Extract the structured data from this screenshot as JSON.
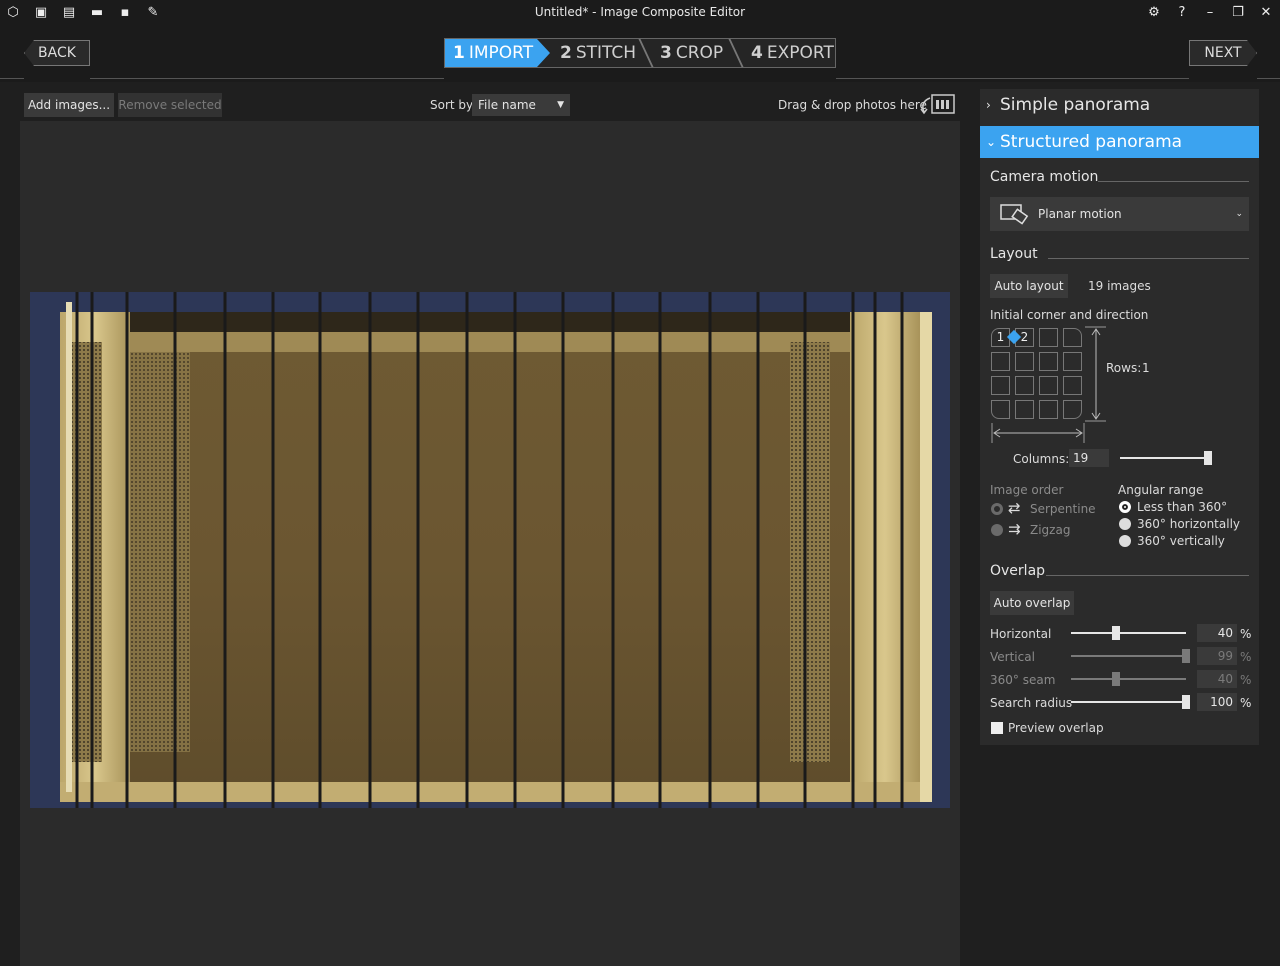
{
  "window": {
    "title": "Untitled* - Image Composite Editor"
  },
  "nav": {
    "back": "BACK",
    "next": "NEXT"
  },
  "steps": [
    {
      "num": "1",
      "label": "IMPORT"
    },
    {
      "num": "2",
      "label": "STITCH"
    },
    {
      "num": "3",
      "label": "CROP"
    },
    {
      "num": "4",
      "label": "EXPORT"
    }
  ],
  "toolbar": {
    "add_images": "Add images...",
    "remove_selected": "Remove selected",
    "sort_by": "Sort by",
    "sort_value": "File name",
    "drag_drop": "Drag & drop photos here"
  },
  "panel": {
    "simple": "Simple panorama",
    "structured": "Structured panorama",
    "camera_motion": "Camera motion",
    "camera_motion_value": "Planar motion",
    "layout": "Layout",
    "auto_layout": "Auto layout",
    "image_count": "19 images",
    "initial_corner": "Initial corner and direction",
    "grid_1": "1",
    "grid_2": "2",
    "rows_label": "Rows:",
    "rows_value": "1",
    "columns_label": "Columns:",
    "columns_value": "19",
    "image_order": "Image order",
    "serpentine": "Serpentine",
    "zigzag": "Zigzag",
    "angular_range": "Angular range",
    "less_than_360": "Less than 360°",
    "h360": "360° horizontally",
    "v360": "360° vertically",
    "overlap": "Overlap",
    "auto_overlap": "Auto overlap",
    "horizontal": "Horizontal",
    "horizontal_value": "40",
    "vertical": "Vertical",
    "vertical_value": "99",
    "seam": "360° seam",
    "seam_value": "40",
    "search_radius": "Search radius",
    "search_radius_value": "100",
    "percent": "%",
    "preview_overlap": "Preview overlap"
  },
  "colors": {
    "accent": "#3ba3f0"
  }
}
